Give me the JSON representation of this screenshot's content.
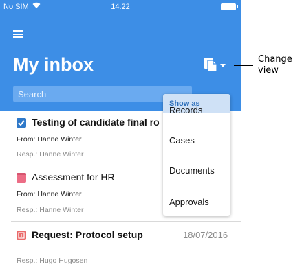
{
  "status_bar": {
    "carrier": "No SIM",
    "time": "14.22"
  },
  "header": {
    "title": "My inbox"
  },
  "search": {
    "placeholder": "Search"
  },
  "items": [
    {
      "icon": "checkbox-icon",
      "title": "Testing of candidate final ro",
      "from": "From: Hanne Winter",
      "resp": "Resp.: Hanne Winter",
      "bold": true
    },
    {
      "icon": "tag-icon",
      "title": "Assessment for HR",
      "from": "From: Hanne Winter",
      "resp": "Resp.: Hanne Winter",
      "bold": false
    },
    {
      "icon": "request-icon",
      "title": "Request: Protocol setup",
      "date": "18/07/2016",
      "resp": "Resp.: Hugo Hugosen",
      "bold": true
    }
  ],
  "dropdown": {
    "header": "Show as",
    "options": [
      "Records",
      "Cases",
      "Documents",
      "Approvals"
    ]
  },
  "callout": {
    "line1": "Change",
    "line2": "view"
  },
  "colors": {
    "header": "#3d8ee6",
    "accent": "#2d6fba",
    "menu_header": "#cfe1f6"
  }
}
